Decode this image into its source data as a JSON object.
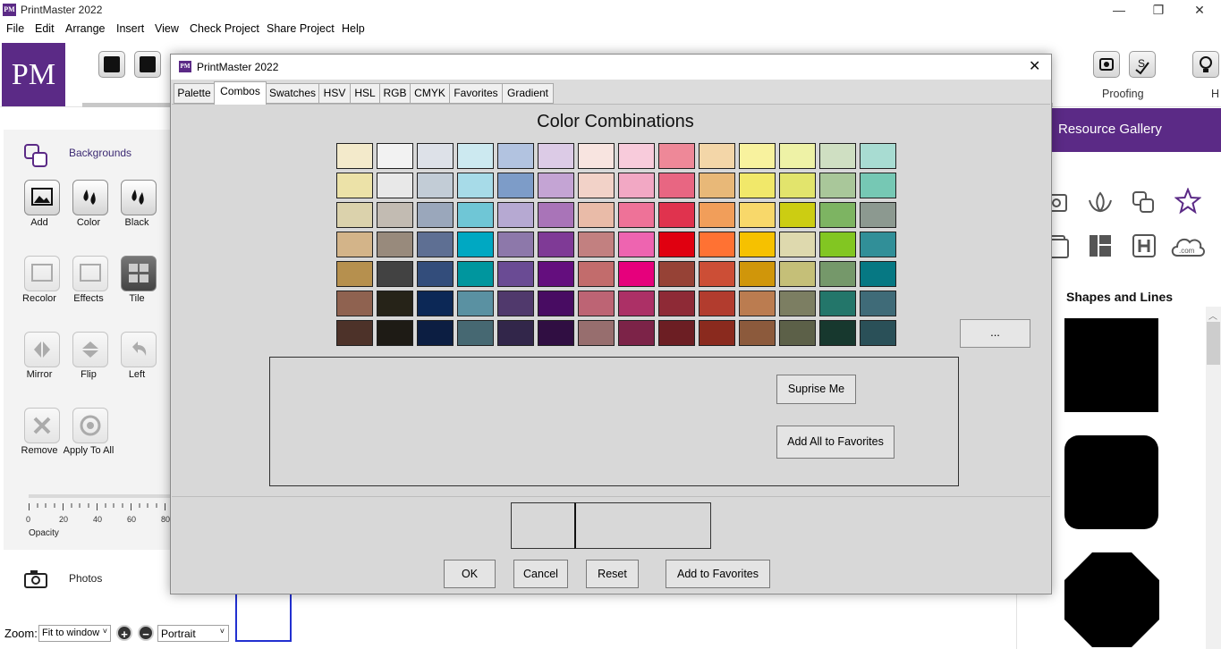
{
  "app": {
    "logo_small": "PM",
    "title": "PrintMaster 2022",
    "logo_large": "PM",
    "window_controls": [
      "—",
      "❐",
      "✕"
    ]
  },
  "menu": [
    "File",
    "Edit",
    "Arrange",
    "Insert",
    "View",
    "Check Project",
    "Share Project",
    "Help"
  ],
  "ribbon": {
    "proofing_label": "Proofing",
    "h_label": "H"
  },
  "left_panel": {
    "section_title": "Backgrounds",
    "buttons": [
      {
        "label": "Add"
      },
      {
        "label": "Color"
      },
      {
        "label": "Black"
      },
      {
        "label": "Recolor"
      },
      {
        "label": "Effects"
      },
      {
        "label": "Tile"
      },
      {
        "label": "Mirror"
      },
      {
        "label": "Flip"
      },
      {
        "label": "Left"
      },
      {
        "label": "Remove"
      },
      {
        "label": "Apply To All"
      }
    ],
    "opacity_ticks": [
      "0",
      "20",
      "40",
      "60",
      "80"
    ],
    "opacity_label": "Opacity",
    "photos_label": "Photos"
  },
  "bottom_bar": {
    "zoom_label": "Zoom:",
    "zoom_value": "Fit to window",
    "zoom_in": "+",
    "zoom_out": "−",
    "orientation": "Portrait"
  },
  "right_panel": {
    "header": "Resource Gallery",
    "shapes_title": "Shapes and Lines"
  },
  "dialog": {
    "logo": "PM",
    "title": "PrintMaster 2022",
    "close": "✕",
    "tabs": [
      "Palette",
      "Combos",
      "Swatches",
      "HSV",
      "HSL",
      "RGB",
      "CMYK",
      "Favorites",
      "Gradient"
    ],
    "active_tab": "Combos",
    "heading": "Color Combinations",
    "more_button": "...",
    "surprise_button": "Suprise Me",
    "add_all_button": "Add All to Favorites",
    "ok_button": "OK",
    "cancel_button": "Cancel",
    "reset_button": "Reset",
    "add_favorites_button": "Add to Favorites",
    "swatches": [
      [
        "#f3eacb",
        "#f2f2f2",
        "#dde1e8",
        "#cce9f0",
        "#b2c3e0",
        "#dccbe6",
        "#f8e4e0",
        "#f8cbdb",
        "#ee8898",
        "#f3d6a8",
        "#f8f29e",
        "#eef2a6",
        "#cfdfc2",
        "#a8dcd2"
      ],
      [
        "#ece2a8",
        "#e8e8e8",
        "#c2ccd6",
        "#a7dbe8",
        "#7d9cc8",
        "#c4a4d4",
        "#f2d2c8",
        "#f2a8c4",
        "#e86682",
        "#e8b878",
        "#f1e86a",
        "#e2e46c",
        "#a9c79a",
        "#76c8b4"
      ],
      [
        "#dbd2ac",
        "#c2bbb2",
        "#9aa7bb",
        "#6fc6d6",
        "#b6a9d2",
        "#a974b8",
        "#e9bba8",
        "#ee7298",
        "#e0334e",
        "#f19e5a",
        "#f8d86a",
        "#cccd12",
        "#7db462",
        "#8c9990"
      ],
      [
        "#d3b489",
        "#988a7c",
        "#5e6f93",
        "#00a8c2",
        "#8d78aa",
        "#7f3a96",
        "#c28080",
        "#ee64b0",
        "#e00010",
        "#ff7233",
        "#f6c100",
        "#ded9ae",
        "#82c622",
        "#318f98"
      ],
      [
        "#b6904e",
        "#424242",
        "#334d7b",
        "#00969e",
        "#6a4b94",
        "#640e7e",
        "#c26c6c",
        "#e6007c",
        "#964236",
        "#cc4e36",
        "#d0960a",
        "#c5bf78",
        "#75986a",
        "#067883"
      ],
      [
        "#8f6250",
        "#262318",
        "#0c2856",
        "#5a91a2",
        "#50396c",
        "#480c62",
        "#bd6474",
        "#ac3066",
        "#8e2a36",
        "#b23c2e",
        "#bb7c50",
        "#7c7e62",
        "#23766a",
        "#3f6b78"
      ],
      [
        "#4d3229",
        "#1e1b15",
        "#0c1e42",
        "#466872",
        "#32264a",
        "#300e42",
        "#976e6e",
        "#7c2348",
        "#6c1e23",
        "#8a2a1e",
        "#8c5a3c",
        "#5c6048",
        "#17382e",
        "#2a5058"
      ]
    ]
  }
}
